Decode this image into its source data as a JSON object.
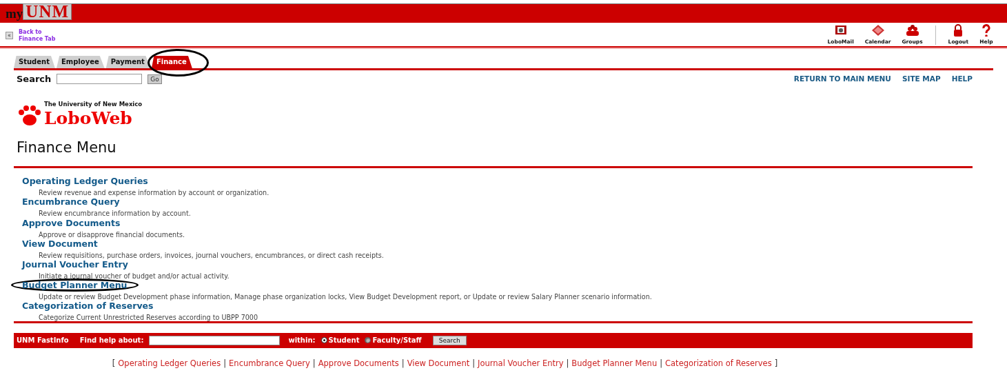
{
  "header": {
    "logo_prefix": "my",
    "logo_main": "UNM"
  },
  "back_link": {
    "icon": "«",
    "lines": [
      "Back to",
      "Finance Tab"
    ]
  },
  "toolbar": [
    {
      "label": "LoboMail",
      "kind": "mail"
    },
    {
      "label": "Calendar",
      "kind": "calendar"
    },
    {
      "label": "Groups",
      "kind": "groups"
    },
    {
      "label": "Logout",
      "kind": "logout"
    },
    {
      "label": "Help",
      "kind": "help"
    }
  ],
  "tabs": [
    {
      "label": "Student",
      "selected": false,
      "circled": false
    },
    {
      "label": "Employee",
      "selected": false,
      "circled": false
    },
    {
      "label": "Payment",
      "selected": false,
      "circled": false
    },
    {
      "label": "Finance",
      "selected": true,
      "circled": true
    }
  ],
  "search": {
    "label": "Search",
    "button": "Go"
  },
  "top_links": [
    "RETURN TO MAIN MENU",
    "SITE MAP",
    "HELP"
  ],
  "logo": {
    "subtitle": "The University of New Mexico",
    "title": "LoboWeb"
  },
  "heading": "Finance Menu",
  "menu_items": [
    {
      "title": "Operating Ledger Queries",
      "description": "Review revenue and expense information by account or organization.",
      "circled": false
    },
    {
      "title": "Encumbrance Query",
      "description": "Review encumbrance information by account.",
      "circled": false
    },
    {
      "title": "Approve Documents",
      "description": "Approve or disapprove financial documents.",
      "circled": false
    },
    {
      "title": "View Document",
      "description": "Review requisitions, purchase orders, invoices, journal vouchers, encumbrances, or direct cash receipts.",
      "circled": false
    },
    {
      "title": "Journal Voucher Entry",
      "description": "Initiate a journal voucher of budget and/or actual activity.",
      "circled": false
    },
    {
      "title": "Budget Planner Menu",
      "description": "Update or review Budget Development phase information, Manage phase organization locks, View Budget Development report, or Update or review Salary Planner scenario information.",
      "circled": true
    },
    {
      "title": "Categorization of Reserves",
      "description": "Categorize Current Unrestricted Reserves according to UBPP 7000",
      "circled": false
    }
  ],
  "fastinfo": {
    "title": "UNM FastInfo",
    "find_label": "Find help about:",
    "within_label": "within:",
    "options": [
      {
        "label": "Student",
        "selected": true
      },
      {
        "label": "Faculty/Staff",
        "selected": false
      }
    ],
    "button": "Search"
  },
  "footer_links": [
    {
      "kind": "bracket",
      "text": "["
    },
    {
      "kind": "link",
      "text": "Operating Ledger Queries"
    },
    {
      "kind": "separator",
      "text": "|"
    },
    {
      "kind": "link",
      "text": "Encumbrance Query"
    },
    {
      "kind": "separator",
      "text": "|"
    },
    {
      "kind": "link",
      "text": "Approve Documents"
    },
    {
      "kind": "separator",
      "text": "|"
    },
    {
      "kind": "link",
      "text": "View Document"
    },
    {
      "kind": "separator",
      "text": "|"
    },
    {
      "kind": "link",
      "text": "Journal Voucher Entry"
    },
    {
      "kind": "separator",
      "text": "|"
    },
    {
      "kind": "link",
      "text": "Budget Planner Menu"
    },
    {
      "kind": "separator",
      "text": "|"
    },
    {
      "kind": "link",
      "text": "Categorization of Reserves"
    },
    {
      "kind": "bracket",
      "text": "]"
    }
  ]
}
